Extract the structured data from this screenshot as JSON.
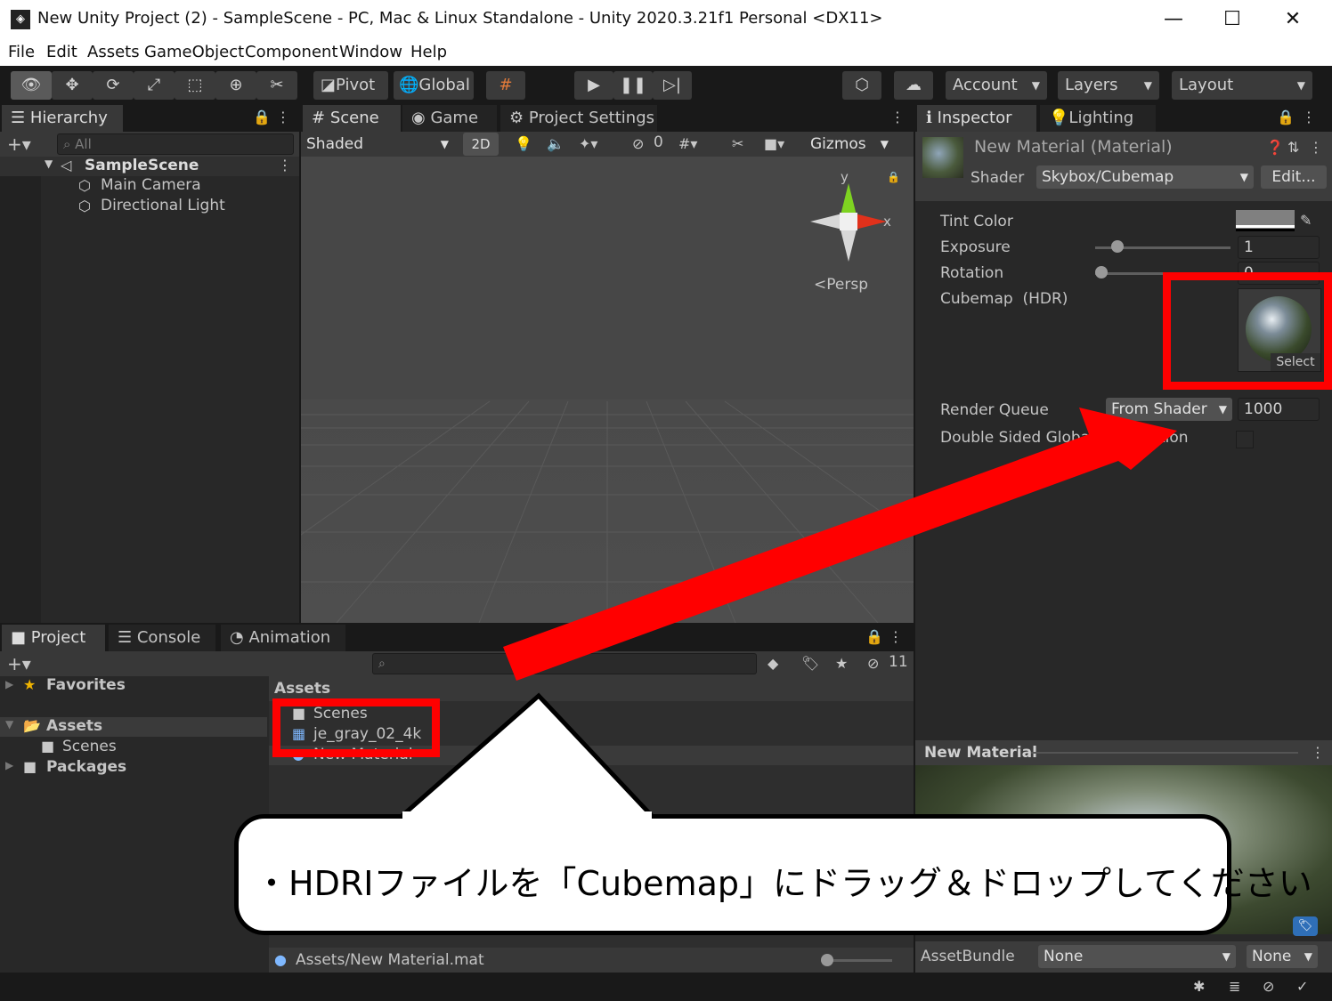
{
  "window": {
    "title": "New Unity Project (2) - SampleScene - PC, Mac & Linux Standalone - Unity 2020.3.21f1 Personal <DX11>",
    "minimize": "—",
    "maximize": "☐",
    "close": "✕"
  },
  "menu": [
    "File",
    "Edit",
    "Assets",
    "GameObject",
    "Component",
    "Window",
    "Help"
  ],
  "toolbar": {
    "pivot": "Pivot",
    "global": "Global",
    "account": "Account",
    "layers": "Layers",
    "layout": "Layout"
  },
  "hierarchy": {
    "tab": "Hierarchy",
    "search_placeholder": "All",
    "scene": "SampleScene",
    "items": [
      "Main Camera",
      "Directional Light"
    ]
  },
  "scene_view": {
    "tabs": [
      "Scene",
      "Game",
      "Project Settings"
    ],
    "shading": "Shaded",
    "mode_2d": "2D",
    "hidden_count": "0",
    "gizmos": "Gizmos",
    "axis_y": "y",
    "axis_x": "x",
    "persp": "Persp"
  },
  "inspector": {
    "tabs": [
      "Inspector",
      "Lighting"
    ],
    "material_name": "New Material (Material)",
    "shader_label": "Shader",
    "shader_value": "Skybox/Cubemap",
    "edit_button": "Edit...",
    "props": {
      "tint_color": "Tint Color",
      "exposure": "Exposure",
      "exposure_value": "1",
      "exposure_level": 0.0,
      "rotation": "Rotation",
      "rotation_value": "0",
      "rotation_level": 0.0,
      "cubemap": "Cubemap",
      "cubemap_hdr": "(HDR)",
      "select": "Select",
      "render_queue": "Render Queue",
      "render_queue_mode": "From Shader",
      "render_queue_value": "1000",
      "double_sided": "Double Sided Global Illumination"
    },
    "preview_title": "New Material",
    "assetbundle_label": "AssetBundle",
    "assetbundle_value": "None",
    "assetbundle_variant": "None"
  },
  "project": {
    "tabs": [
      "Project",
      "Console",
      "Animation"
    ],
    "hidden_count": "11",
    "tree": {
      "favorites": "Favorites",
      "assets": "Assets",
      "scenes": "Scenes",
      "packages": "Packages"
    },
    "breadcrumb": "Assets",
    "files": [
      "Scenes",
      "je_gray_02_4k",
      "New Material"
    ],
    "status_path": "Assets/New Material.mat"
  },
  "annotation": {
    "callout": "・HDRIファイルを「Cubemap」にドラッグ＆ドロップしてください"
  },
  "colors": {
    "annotation_red": "#ff0000",
    "panel_bg": "#282828",
    "tab_active": "#383838"
  }
}
